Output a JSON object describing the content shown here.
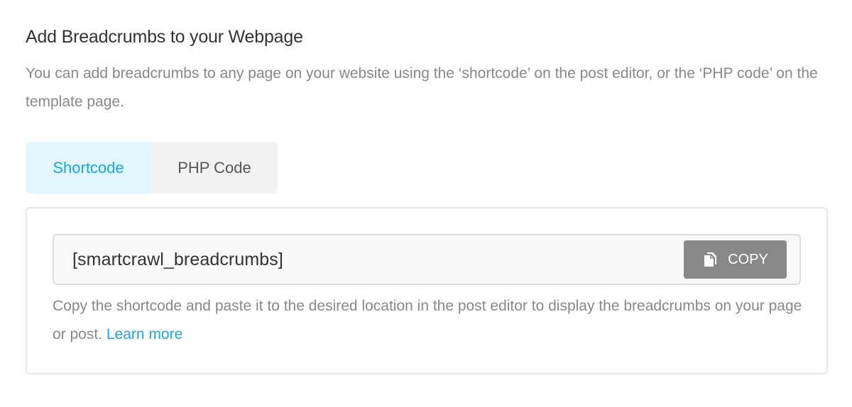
{
  "section": {
    "title": "Add Breadcrumbs to your Webpage",
    "description": "You can add breadcrumbs to any page on your website using the ‘shortcode’ on the post editor, or the ‘PHP code’ on the template page."
  },
  "tabs": [
    {
      "label": "Shortcode",
      "active": true
    },
    {
      "label": "PHP Code",
      "active": false
    }
  ],
  "panel": {
    "code": "[smartcrawl_breadcrumbs]",
    "copy_label": "COPY",
    "copy_icon": "copy-icon",
    "help_text": "Copy the shortcode and paste it to the desired location in the post editor to display the breadcrumbs on your page or post. ",
    "learn_more_label": "Learn more"
  },
  "colors": {
    "accent": "#17a8e3",
    "active_tab_bg": "#e1f6ff",
    "copy_button_bg": "#888888"
  }
}
